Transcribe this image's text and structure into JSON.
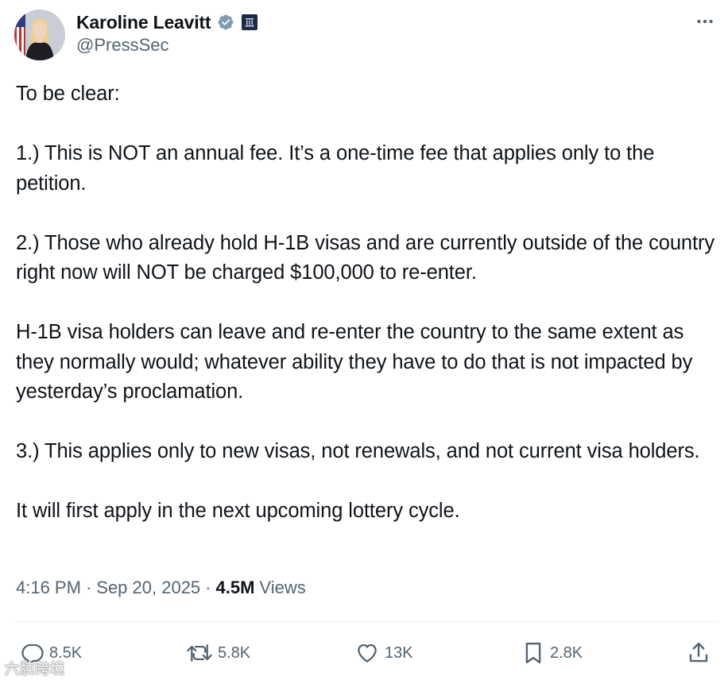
{
  "author": {
    "display_name": "Karoline Leavitt",
    "handle": "@PressSec",
    "verified_badge_color": "#829aab",
    "affiliation_badge_color": "#1c2a44"
  },
  "tweet": {
    "paragraphs": [
      "To be clear:",
      "1.) This is NOT an annual fee. It’s a one-time fee that applies only to the petition.",
      "2.) Those who already hold H-1B visas and are currently outside of the country right now will NOT be charged $100,000 to re-enter.",
      "H-1B visa holders can leave and re-enter the country to the same extent as they normally would; whatever ability they have to do that is not impacted by yesterday’s proclamation.",
      "3.) This applies only to new visas, not renewals, and not current visa holders.",
      "It will first apply in the next upcoming lottery cycle."
    ],
    "time": "4:16 PM",
    "date": "Sep 20, 2025",
    "views_count": "4.5M",
    "views_label": "Views"
  },
  "actions": {
    "replies": "8.5K",
    "reposts": "5.8K",
    "likes": "13K",
    "bookmarks": "2.8K"
  },
  "icons": {
    "more": "more-horizontal-icon",
    "reply": "reply-icon",
    "repost": "repost-icon",
    "like": "heart-icon",
    "bookmark": "bookmark-icon",
    "share": "share-icon"
  },
  "watermark": "六牍跨境",
  "colors": {
    "text_primary": "#0f1419",
    "text_secondary": "#536471",
    "divider": "#eff3f4"
  }
}
